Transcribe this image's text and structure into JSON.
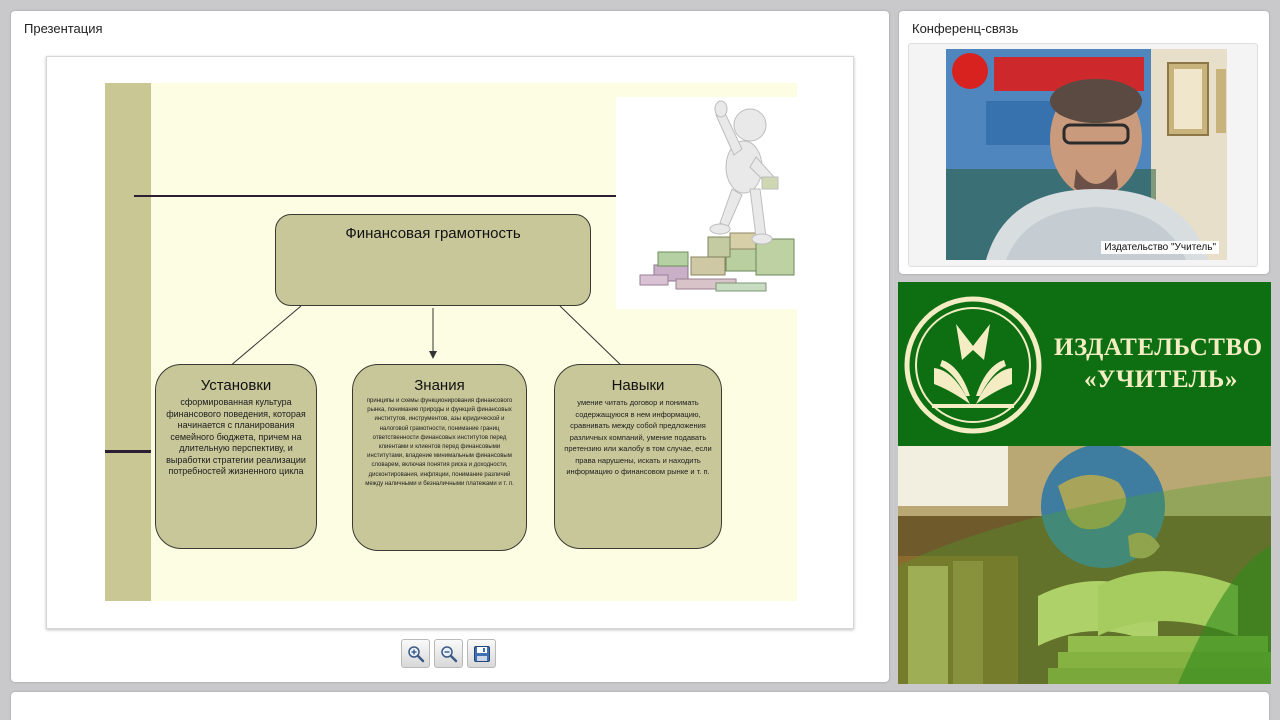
{
  "presentation": {
    "title": "Презентация",
    "slide": {
      "main_title": "Финансовая грамотность",
      "boxes": [
        {
          "title": "Установки",
          "text": "сформированная культура финансового поведения, которая начинается с планирования семейного бюджета, причем на длительную перспективу, и выработки стратегии реализации потребностей жизненного цикла"
        },
        {
          "title": "Знания",
          "text": "принципы и схемы функционирования финансового рынка, понимание природы и функций финансовых институтов, инструментов, азы юридической и налоговой грамотности, понимание границ ответственности финансовых институтов перед клиентами и клиентов перед финансовыми институтами, владение минимальным финансовым словарем, включая понятия риска и доходности, дисконтирования, инфляции, понимание различий между наличными и безналичными платежами и т. п."
        },
        {
          "title": "Навыки",
          "text": "умение читать договор и понимать содержащуюся в нем информацию, сравнивать между собой предложения различных компаний, умение подавать претензию или жалобу в том случае, если права нарушены, искать и находить информацию о финансовом рынке и т. п."
        }
      ]
    },
    "toolbar": {
      "zoom_in_icon": "zoom-in-icon",
      "zoom_out_icon": "zoom-out-icon",
      "save_icon": "floppy-disk-icon"
    }
  },
  "conference": {
    "title": "Конференц-связь",
    "participant_name": "Издательство \"Учитель\""
  },
  "banner": {
    "line1": "ИЗДАТЕЛЬСТВО",
    "line2": "«УЧИТЕЛЬ»"
  },
  "colors": {
    "slide_background": "#fdfde3",
    "slide_box": "#c8c79a",
    "banner_green": "#0d6f12",
    "banner_text": "#f4edc4"
  }
}
